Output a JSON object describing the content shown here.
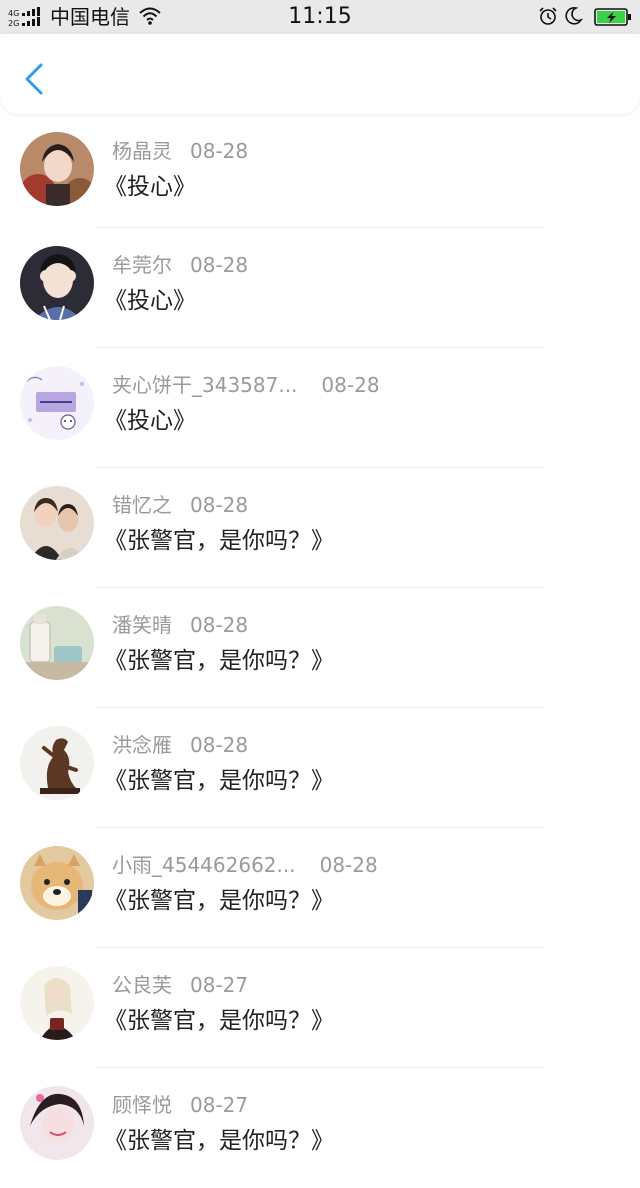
{
  "status_bar": {
    "network": "4G 2G",
    "carrier": "中国电信",
    "time": "11:15"
  },
  "header": {
    "back_icon": "chevron-left-icon",
    "accent_color": "#2b9cf0"
  },
  "items": [
    {
      "name": "杨晶灵",
      "date": "08-28",
      "title": "《投心》"
    },
    {
      "name": "牟莞尔",
      "date": "08-28",
      "title": "《投心》"
    },
    {
      "name": "夹心饼干_343587...",
      "date": "08-28",
      "title": "《投心》"
    },
    {
      "name": "错忆之",
      "date": "08-28",
      "title": "《张警官，是你吗？》"
    },
    {
      "name": "潘笑晴",
      "date": "08-28",
      "title": "《张警官，是你吗？》"
    },
    {
      "name": "洪念雁",
      "date": "08-28",
      "title": "《张警官，是你吗？》"
    },
    {
      "name": "小雨_454462662...",
      "date": "08-28",
      "title": "《张警官，是你吗？》"
    },
    {
      "name": "公良芙",
      "date": "08-27",
      "title": "《张警官，是你吗？》"
    },
    {
      "name": "顾怿悦",
      "date": "08-27",
      "title": "《张警官，是你吗？》"
    }
  ]
}
